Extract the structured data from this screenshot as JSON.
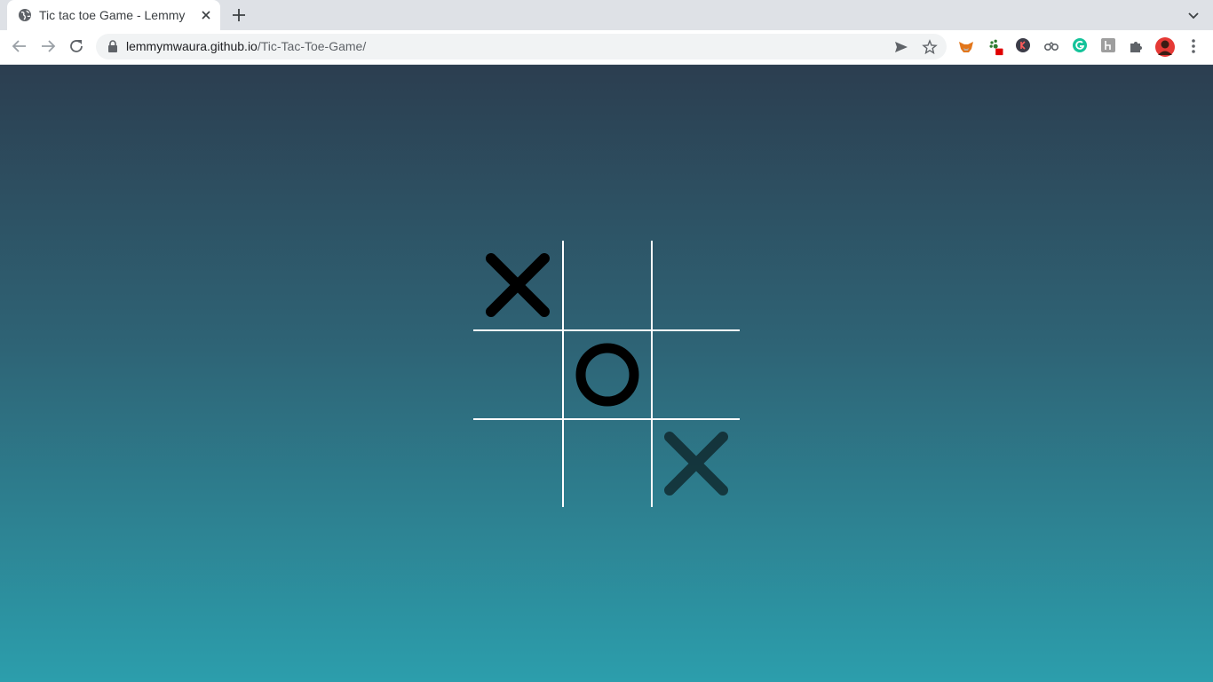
{
  "browser": {
    "tab": {
      "title": "Tic tac toe Game - Lemmy",
      "favicon": "globe-icon"
    },
    "address_bar": {
      "host": "lemmymwaura.github.io",
      "path": "/Tic-Tac-Toe-Game/"
    },
    "extensions": [
      "metamask-fox-icon",
      "paw-icon",
      "k-icon",
      "binoculars-icon",
      "grammarly-icon",
      "puzzle-dark-icon",
      "extensions-icon",
      "profile-avatar",
      "menu-dots-icon"
    ]
  },
  "game": {
    "board": [
      [
        "X",
        "",
        ""
      ],
      [
        "",
        "O",
        ""
      ],
      [
        "",
        "",
        "X"
      ]
    ],
    "hover_preview": {
      "row": 2,
      "col": 2
    },
    "colors": {
      "background_top": "#2c3e50",
      "background_bottom": "#2c9eac",
      "grid_lines": "#ffffff",
      "marks": "#000000"
    }
  }
}
